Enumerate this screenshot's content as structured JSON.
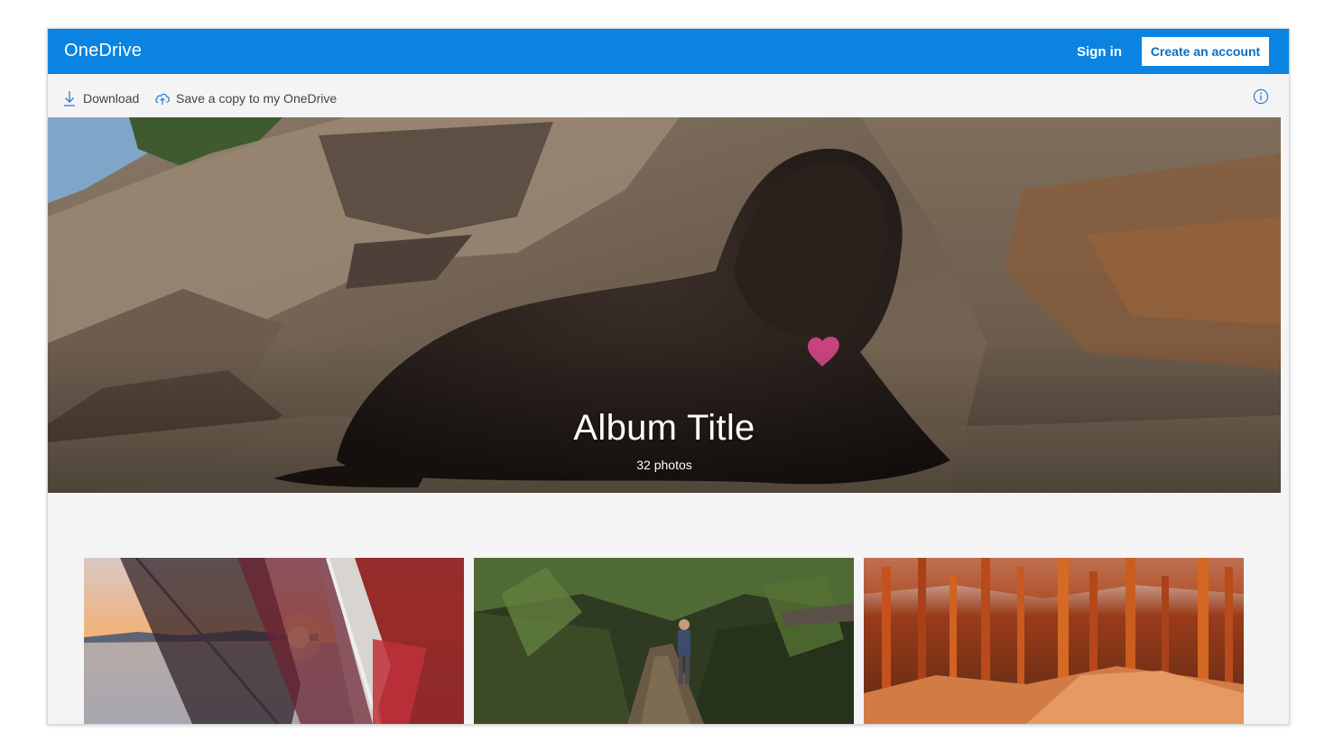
{
  "header": {
    "brand": "OneDrive",
    "sign_in_label": "Sign in",
    "create_account_label": "Create an account",
    "accent_color": "#0a84e0"
  },
  "commands": {
    "download_label": "Download",
    "download_icon": "download-icon",
    "save_copy_label": "Save a copy to my OneDrive",
    "save_copy_icon": "cloud-upload-icon",
    "info_icon": "info-icon"
  },
  "album": {
    "title": "Album Title",
    "count_label": "32 photos",
    "cover_subject": "cover-photo"
  },
  "thumbnails": [
    {
      "name": "photo-thumbnail-1"
    },
    {
      "name": "photo-thumbnail-2"
    },
    {
      "name": "photo-thumbnail-3"
    }
  ]
}
